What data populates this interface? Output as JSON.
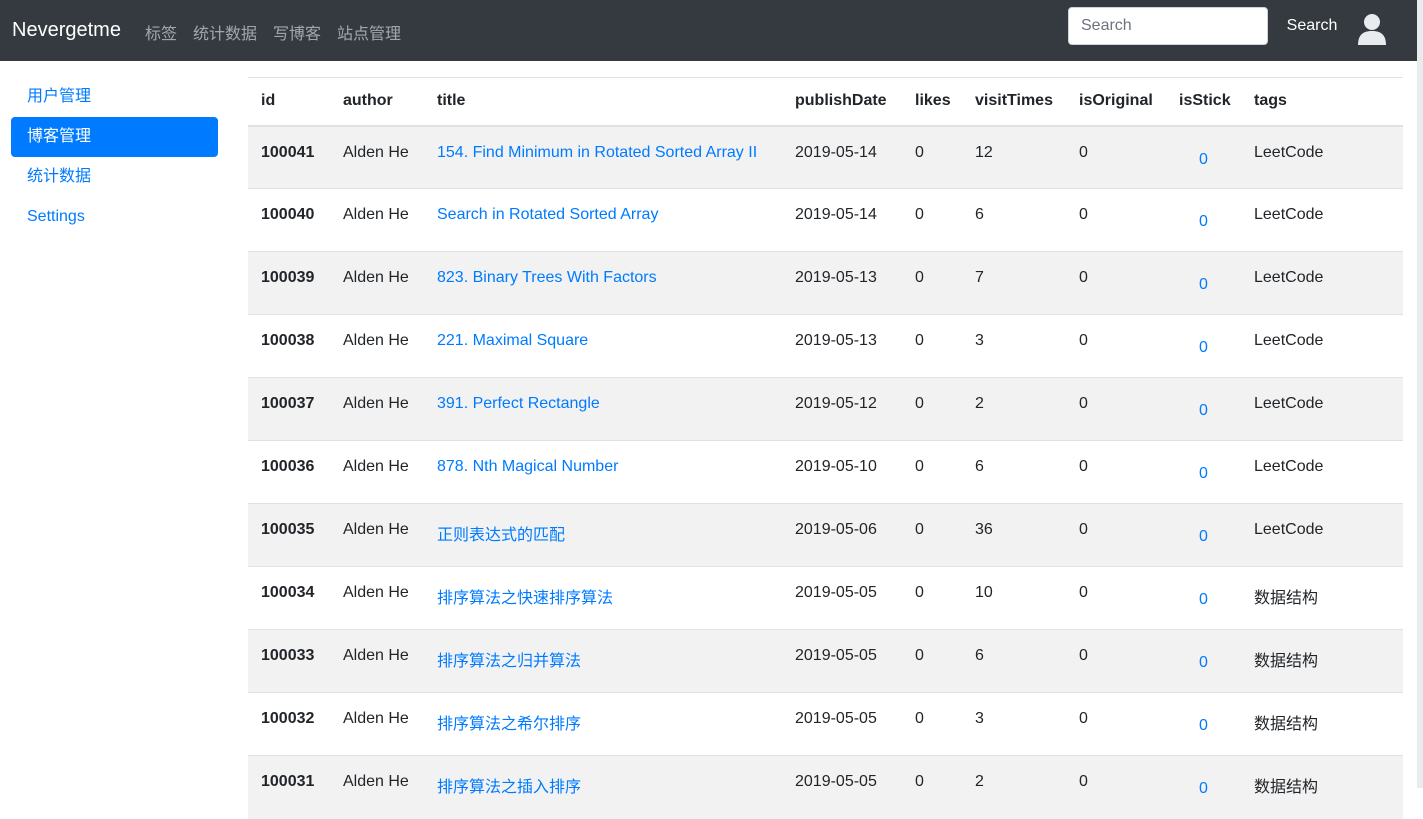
{
  "navbar": {
    "brand": "Nevergetme",
    "links": [
      "标签",
      "统计数据",
      "写博客",
      "站点管理"
    ],
    "search_placeholder": "Search",
    "search_button": "Search",
    "avatar_icon": "user-avatar-icon"
  },
  "sidebar": {
    "items": [
      {
        "label": "用户管理",
        "active": false
      },
      {
        "label": "博客管理",
        "active": true
      },
      {
        "label": "统计数据",
        "active": false
      },
      {
        "label": "Settings",
        "active": false
      }
    ]
  },
  "table": {
    "headers": [
      "id",
      "author",
      "title",
      "publishDate",
      "likes",
      "visitTimes",
      "isOriginal",
      "isStick",
      "tags"
    ],
    "rows": [
      {
        "id": "100041",
        "author": "Alden He",
        "title": "154. Find Minimum in Rotated Sorted Array II",
        "publishDate": "2019-05-14",
        "likes": "0",
        "visitTimes": "12",
        "isOriginal": "0",
        "isStick": "0",
        "tags": "LeetCode"
      },
      {
        "id": "100040",
        "author": "Alden He",
        "title": "Search in Rotated Sorted Array",
        "publishDate": "2019-05-14",
        "likes": "0",
        "visitTimes": "6",
        "isOriginal": "0",
        "isStick": "0",
        "tags": "LeetCode"
      },
      {
        "id": "100039",
        "author": "Alden He",
        "title": "823. Binary Trees With Factors",
        "publishDate": "2019-05-13",
        "likes": "0",
        "visitTimes": "7",
        "isOriginal": "0",
        "isStick": "0",
        "tags": "LeetCode"
      },
      {
        "id": "100038",
        "author": "Alden He",
        "title": "221. Maximal Square",
        "publishDate": "2019-05-13",
        "likes": "0",
        "visitTimes": "3",
        "isOriginal": "0",
        "isStick": "0",
        "tags": "LeetCode"
      },
      {
        "id": "100037",
        "author": "Alden He",
        "title": "391. Perfect Rectangle",
        "publishDate": "2019-05-12",
        "likes": "0",
        "visitTimes": "2",
        "isOriginal": "0",
        "isStick": "0",
        "tags": "LeetCode"
      },
      {
        "id": "100036",
        "author": "Alden He",
        "title": "878. Nth Magical Number",
        "publishDate": "2019-05-10",
        "likes": "0",
        "visitTimes": "6",
        "isOriginal": "0",
        "isStick": "0",
        "tags": "LeetCode"
      },
      {
        "id": "100035",
        "author": "Alden He",
        "title": "正则表达式的匹配",
        "publishDate": "2019-05-06",
        "likes": "0",
        "visitTimes": "36",
        "isOriginal": "0",
        "isStick": "0",
        "tags": "LeetCode"
      },
      {
        "id": "100034",
        "author": "Alden He",
        "title": "排序算法之快速排序算法",
        "publishDate": "2019-05-05",
        "likes": "0",
        "visitTimes": "10",
        "isOriginal": "0",
        "isStick": "0",
        "tags": "数据结构"
      },
      {
        "id": "100033",
        "author": "Alden He",
        "title": "排序算法之归并算法",
        "publishDate": "2019-05-05",
        "likes": "0",
        "visitTimes": "6",
        "isOriginal": "0",
        "isStick": "0",
        "tags": "数据结构"
      },
      {
        "id": "100032",
        "author": "Alden He",
        "title": "排序算法之希尔排序",
        "publishDate": "2019-05-05",
        "likes": "0",
        "visitTimes": "3",
        "isOriginal": "0",
        "isStick": "0",
        "tags": "数据结构"
      },
      {
        "id": "100031",
        "author": "Alden He",
        "title": "排序算法之插入排序",
        "publishDate": "2019-05-05",
        "likes": "0",
        "visitTimes": "2",
        "isOriginal": "0",
        "isStick": "0",
        "tags": "数据结构"
      }
    ]
  }
}
